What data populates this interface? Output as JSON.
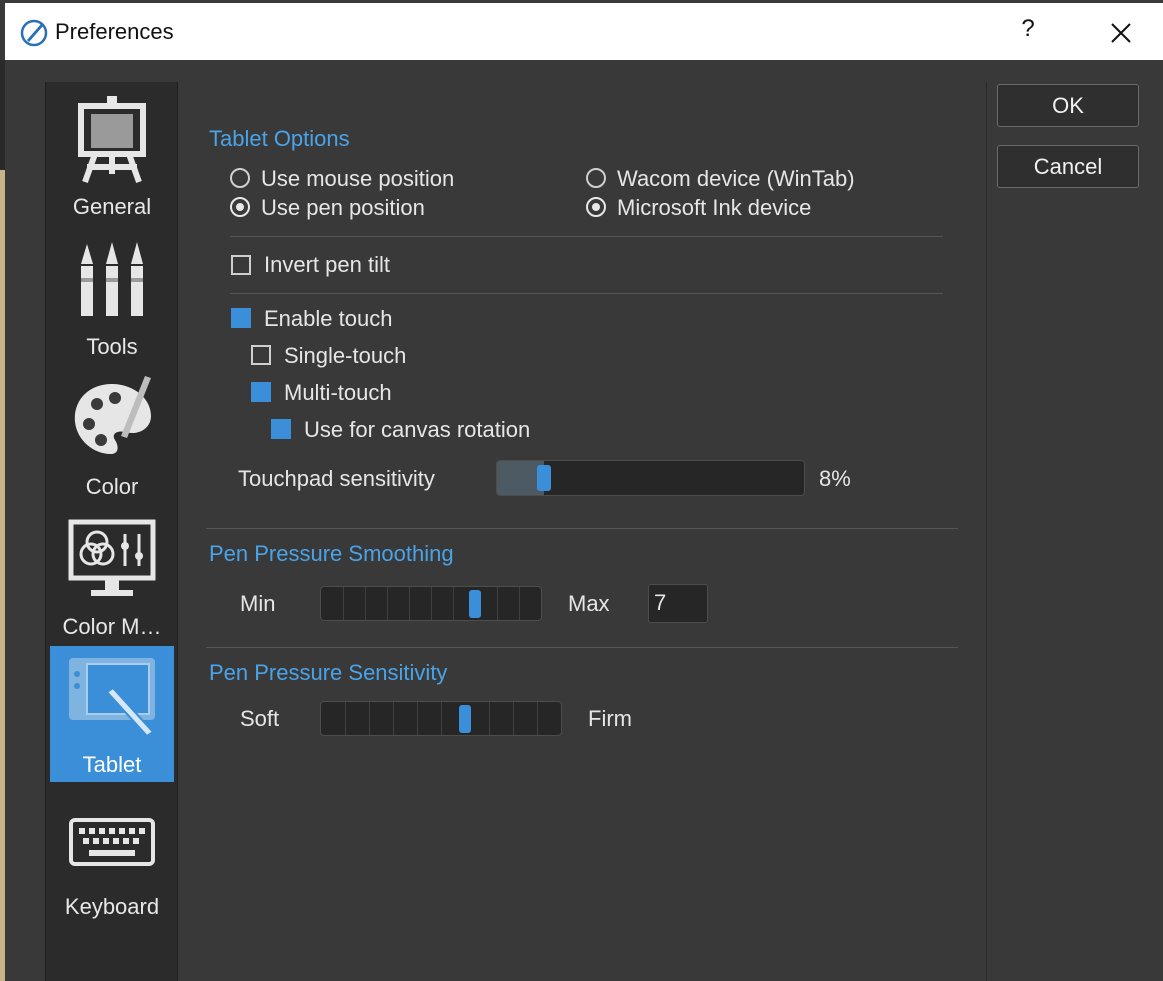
{
  "window": {
    "title": "Preferences",
    "help_glyph": "?",
    "close_glyph": "close-icon"
  },
  "sidebar": {
    "items": [
      {
        "label": "General",
        "icon": "easel-icon",
        "active": false
      },
      {
        "label": "Tools",
        "icon": "brushes-icon",
        "active": false
      },
      {
        "label": "Color",
        "icon": "palette-icon",
        "active": false
      },
      {
        "label": "Color M…",
        "icon": "monitor-color-icon",
        "active": false
      },
      {
        "label": "Tablet",
        "icon": "tablet-icon",
        "active": true
      },
      {
        "label": "Keyboard",
        "icon": "keyboard-icon",
        "active": false
      }
    ]
  },
  "tablet_options": {
    "title": "Tablet Options",
    "radios": {
      "use_mouse_position": "Use mouse position",
      "use_pen_position": "Use pen position",
      "wacom_device": "Wacom device (WinTab)",
      "microsoft_ink": "Microsoft Ink device"
    },
    "selected_position": "Use pen position",
    "selected_device": "Microsoft Ink device",
    "invert_pen_tilt": "Invert pen tilt",
    "enable_touch": "Enable touch",
    "single_touch": "Single-touch",
    "multi_touch": "Multi-touch",
    "canvas_rotation": "Use for canvas rotation",
    "touchpad_label": "Touchpad sensitivity",
    "touchpad_value": "8%",
    "touchpad_fraction": 0.08
  },
  "pen_pressure_smoothing": {
    "title": "Pen Pressure Smoothing",
    "min_label": "Min",
    "max_label": "Max",
    "value": "7"
  },
  "pen_pressure_sensitivity": {
    "title": "Pen Pressure Sensitivity",
    "soft_label": "Soft",
    "firm_label": "Firm"
  },
  "buttons": {
    "ok": "OK",
    "cancel": "Cancel"
  },
  "colors": {
    "accent": "#3b8fd8",
    "section_title": "#4aa3e8",
    "background": "#393939",
    "sidebar": "#2b2b2b"
  }
}
